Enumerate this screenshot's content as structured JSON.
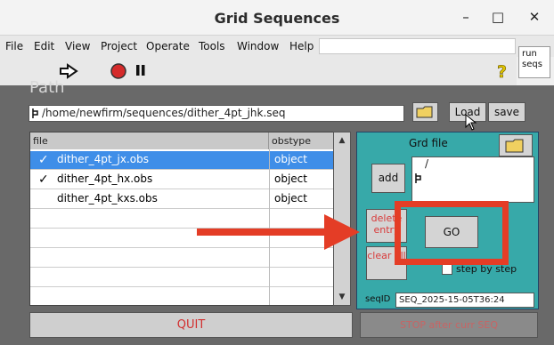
{
  "window": {
    "title": "Grid Sequences",
    "minimize": "–",
    "maximize": "□",
    "close": "✕"
  },
  "menu": [
    "File",
    "Edit",
    "View",
    "Project",
    "Operate",
    "Tools",
    "Window",
    "Help"
  ],
  "run_seqs": "run seqs",
  "path": {
    "label": "Path",
    "value": "/home/newfirm/sequences/dither_4pt_jhk.seq",
    "load": "Load",
    "save": "save"
  },
  "table": {
    "headers": [
      "file",
      "obstype"
    ],
    "rows": [
      {
        "file": "dither_4pt_jx.obs",
        "obstype": "object",
        "checked": true,
        "selected": true
      },
      {
        "file": "dither_4pt_hx.obs",
        "obstype": "object",
        "checked": true,
        "selected": false
      },
      {
        "file": "dither_4pt_kxs.obs",
        "obstype": "object",
        "checked": false,
        "selected": false
      }
    ]
  },
  "grd": {
    "title": "Grd file",
    "add": "add",
    "field_value": "/",
    "delete_entry": "delete entry",
    "clear_all": "clear all",
    "go": "GO",
    "step_by_step": "step by step",
    "seqid_label": "seqID",
    "seqid_value": "SEQ_2025-15-05T36:24"
  },
  "quit": "QUIT",
  "stop": "STOP after curr SEQ",
  "colors": {
    "accent": "#e43d26",
    "panel": "#37a9a9",
    "selection": "#3f8ee8"
  }
}
